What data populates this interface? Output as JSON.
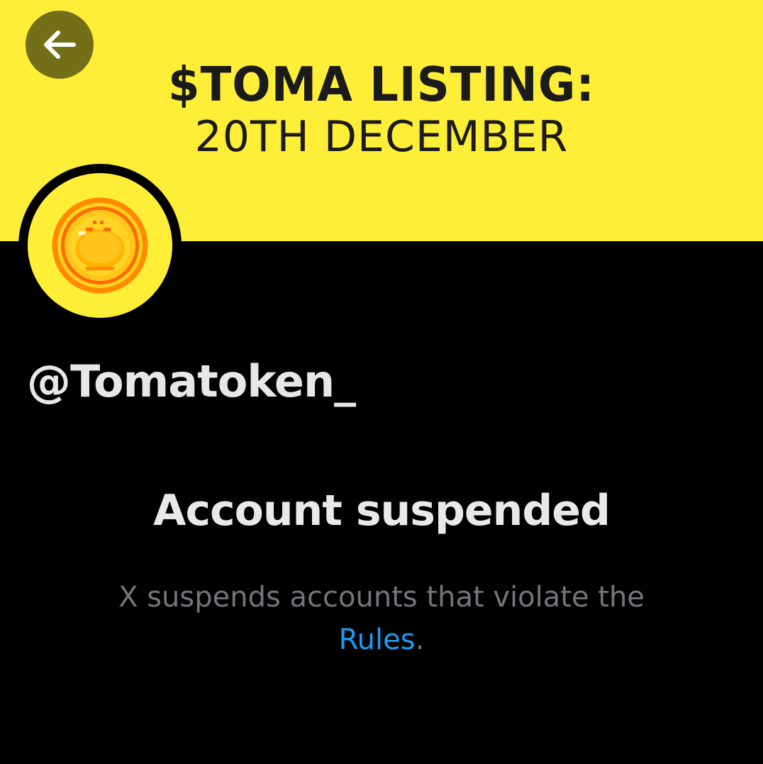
{
  "banner": {
    "line1": "$TOMA LISTING:",
    "line2": "20TH DECEMBER",
    "background_color": "#FFEE37"
  },
  "back_button": {
    "icon": "arrow-left-icon"
  },
  "profile": {
    "avatar_icon": "pixel-coin-icon",
    "handle": "@Tomatoken_"
  },
  "suspension": {
    "title": "Account suspended",
    "description": "X suspends accounts that violate the",
    "link_text": "Rules",
    "trailing": ".",
    "link_color": "#1d9bf0"
  }
}
